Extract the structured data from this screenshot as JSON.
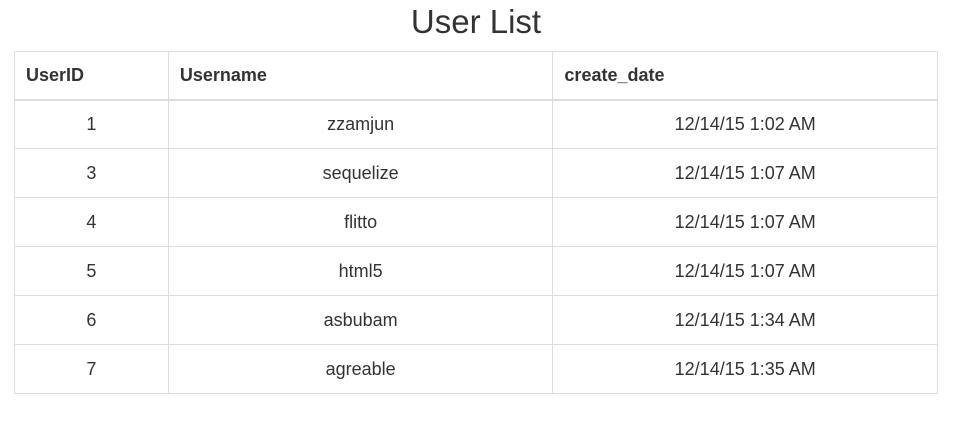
{
  "page": {
    "title": "User List"
  },
  "table": {
    "columns": [
      "UserID",
      "Username",
      "create_date"
    ],
    "rows": [
      {
        "user_id": "1",
        "username": "zzamjun",
        "create_date": "12/14/15 1:02 AM"
      },
      {
        "user_id": "3",
        "username": "sequelize",
        "create_date": "12/14/15 1:07 AM"
      },
      {
        "user_id": "4",
        "username": "flitto",
        "create_date": "12/14/15 1:07 AM"
      },
      {
        "user_id": "5",
        "username": "html5",
        "create_date": "12/14/15 1:07 AM"
      },
      {
        "user_id": "6",
        "username": "asbubam",
        "create_date": "12/14/15 1:34 AM"
      },
      {
        "user_id": "7",
        "username": "agreable",
        "create_date": "12/14/15 1:35 AM"
      }
    ]
  },
  "colors": {
    "text": "#333333",
    "border": "#dddddd",
    "background": "#ffffff"
  }
}
